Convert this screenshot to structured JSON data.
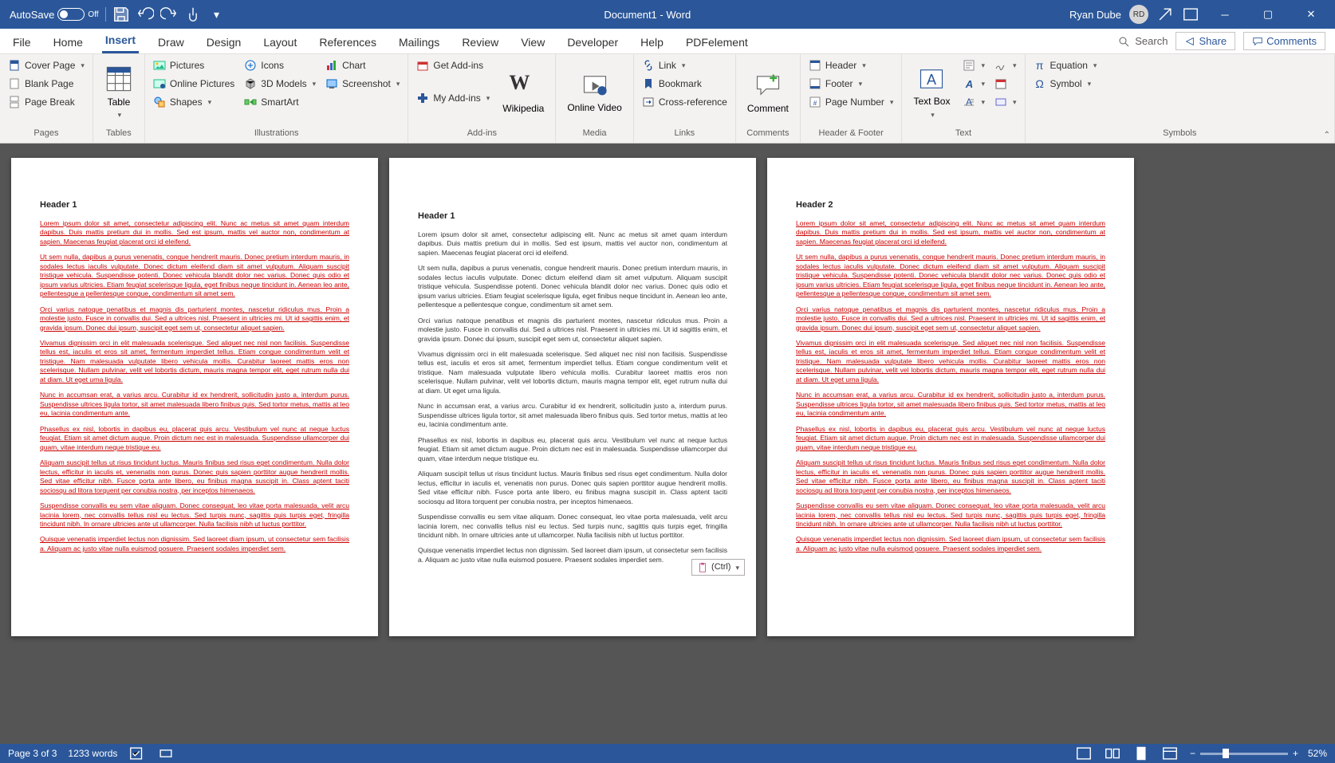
{
  "titlebar": {
    "autosave": "AutoSave",
    "autosave_state": "Off",
    "doc_title": "Document1 - Word",
    "user": "Ryan Dube",
    "initials": "RD"
  },
  "tabs": [
    "File",
    "Home",
    "Insert",
    "Draw",
    "Design",
    "Layout",
    "References",
    "Mailings",
    "Review",
    "View",
    "Developer",
    "Help",
    "PDFelement"
  ],
  "active_tab": "Insert",
  "search_placeholder": "Search",
  "share": "Share",
  "comments_btn": "Comments",
  "ribbon": {
    "pages": {
      "label": "Pages",
      "cover": "Cover Page",
      "blank": "Blank Page",
      "break": "Page Break"
    },
    "tables": {
      "label": "Tables",
      "table": "Table"
    },
    "illustrations": {
      "label": "Illustrations",
      "pictures": "Pictures",
      "online": "Online Pictures",
      "shapes": "Shapes",
      "icons": "Icons",
      "models": "3D Models",
      "smartart": "SmartArt",
      "chart": "Chart",
      "screenshot": "Screenshot"
    },
    "addins": {
      "label": "Add-ins",
      "get": "Get Add-ins",
      "my": "My Add-ins",
      "wikipedia": "Wikipedia"
    },
    "media": {
      "label": "Media",
      "video": "Online Video"
    },
    "links": {
      "label": "Links",
      "link": "Link",
      "bookmark": "Bookmark",
      "cross": "Cross-reference"
    },
    "comments": {
      "label": "Comments",
      "comment": "Comment"
    },
    "headerfooter": {
      "label": "Header & Footer",
      "header": "Header",
      "footer": "Footer",
      "pagenum": "Page Number"
    },
    "text": {
      "label": "Text",
      "textbox": "Text Box"
    },
    "symbols": {
      "label": "Symbols",
      "equation": "Equation",
      "symbol": "Symbol"
    }
  },
  "doc": {
    "h1": "Header 1",
    "h2": "Header 2",
    "p1": "Lorem ipsum dolor sit amet, consectetur adipiscing elit. Nunc ac metus sit amet quam interdum dapibus. Duis mattis pretium dui in mollis. Sed est ipsum, mattis vel auctor non, condimentum at sapien. Maecenas feugiat placerat orci id eleifend.",
    "p2": "Ut sem nulla, dapibus a purus venenatis, congue hendrerit mauris. Donec pretium interdum mauris, in sodales lectus iaculis vulputate. Donec dictum eleifend diam sit amet vulputum. Aliquam suscipit tristique vehicula. Suspendisse potenti. Donec vehicula blandit dolor nec varius. Donec quis odio et ipsum varius ultricies. Etiam feugiat scelerisque ligula, eget finibus neque tincidunt in. Aenean leo ante, pellentesque a pellentesque congue, condimentum sit amet sem.",
    "p3": "Orci varius natoque penatibus et magnis dis parturient montes, nascetur ridiculus mus. Proin a molestie justo. Fusce in convallis dui. Sed a ultrices nisl. Praesent in ultricies mi. Ut id sagittis enim, et gravida ipsum. Donec dui ipsum, suscipit eget sem ut, consectetur aliquet sapien.",
    "p4": "Vivamus dignissim orci in elit malesuada scelerisque. Sed aliquet nec nisl non facilisis. Suspendisse tellus est, iaculis et eros sit amet, fermentum imperdiet tellus. Etiam congue condimentum velit et tristique. Nam malesuada vulputate libero vehicula mollis. Curabitur laoreet mattis eros non scelerisque. Nullam pulvinar, velit vel lobortis dictum, mauris magna tempor elit, eget rutrum nulla dui at diam. Ut eget urna ligula.",
    "p5": "Nunc in accumsan erat, a varius arcu. Curabitur id ex hendrerit, sollicitudin justo a, interdum purus. Suspendisse ultrices ligula tortor, sit amet malesuada libero finibus quis. Sed tortor metus, mattis at leo eu, lacinia condimentum ante.",
    "p6": "Phasellus ex nisl, lobortis in dapibus eu, placerat quis arcu. Vestibulum vel nunc at neque luctus feugiat. Etiam sit amet dictum augue. Proin dictum nec est in malesuada. Suspendisse ullamcorper dui quam, vitae interdum neque tristique eu.",
    "p7": "Aliquam suscipit tellus ut risus tincidunt luctus. Mauris finibus sed risus eget condimentum. Nulla dolor lectus, efficitur in iaculis et, venenatis non purus. Donec quis sapien porttitor augue hendrerit mollis. Sed vitae efficitur nibh. Fusce porta ante libero, eu finibus magna suscipit in. Class aptent taciti sociosqu ad litora torquent per conubia nostra, per inceptos himenaeos.",
    "p8": "Suspendisse convallis eu sem vitae aliquam. Donec consequat, leo vitae porta malesuada, velit arcu lacinia lorem, nec convallis tellus nisl eu lectus. Sed turpis nunc, sagittis quis turpis eget, fringilla tincidunt nibh. In ornare ultricies ante ut ullamcorper. Nulla facilisis nibh ut luctus porttitor.",
    "p9": "Quisque venenatis imperdiet lectus non dignissim. Sed laoreet diam ipsum, ut consectetur sem facilisis a. Aliquam ac justo vitae nulla euismod posuere. Praesent sodales imperdiet sem.",
    "ctrl": "(Ctrl)"
  },
  "status": {
    "page": "Page 3 of 3",
    "words": "1233 words",
    "zoom": "52%"
  }
}
